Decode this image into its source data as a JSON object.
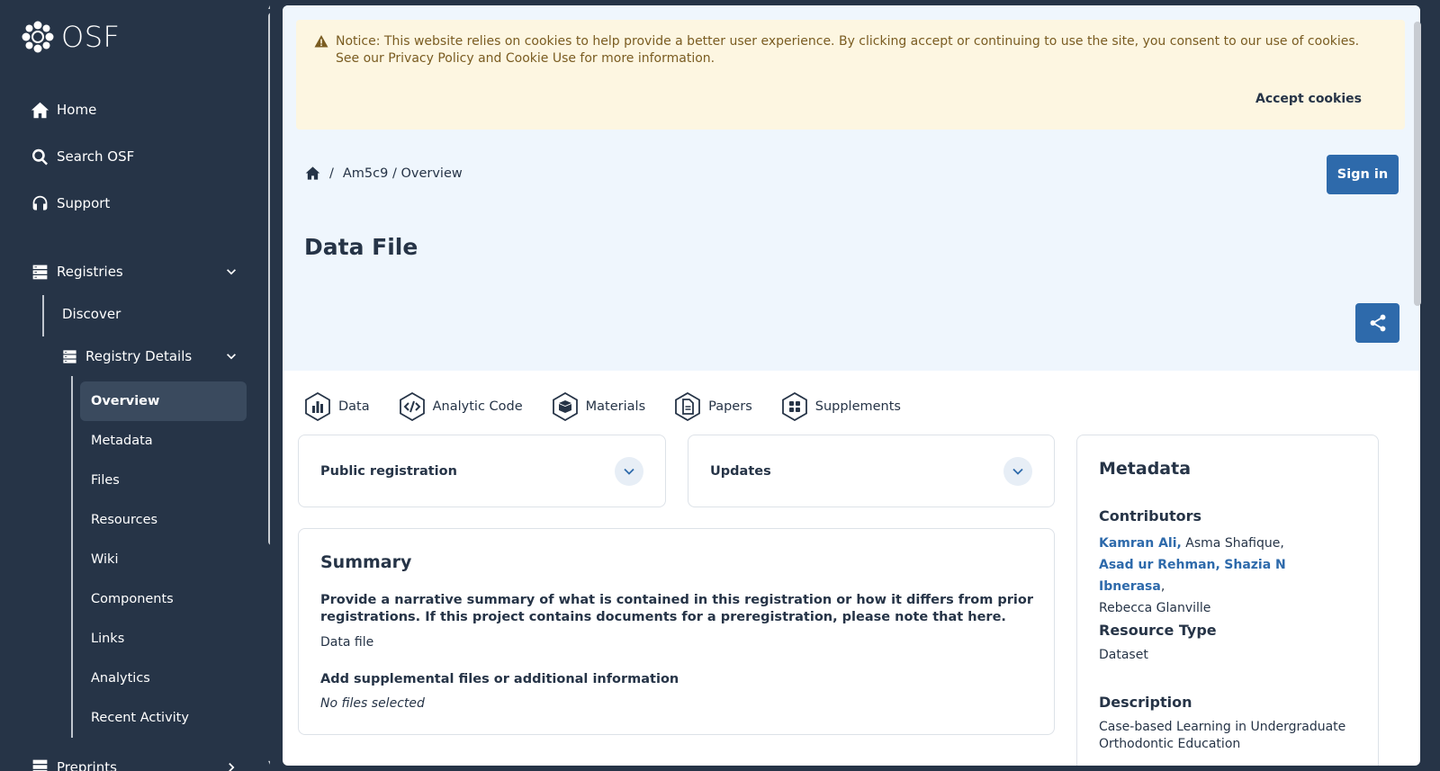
{
  "app": {
    "logo_text": "OSF"
  },
  "sidebar": {
    "nav": [
      {
        "label": "Home",
        "icon": "home-icon"
      },
      {
        "label": "Search OSF",
        "icon": "search-icon"
      },
      {
        "label": "Support",
        "icon": "headset-icon"
      }
    ],
    "registries_label": "Registries",
    "discover_label": "Discover",
    "registry_details_label": "Registry Details",
    "subnav": [
      "Overview",
      "Metadata",
      "Files",
      "Resources",
      "Wiki",
      "Components",
      "Links",
      "Analytics",
      "Recent Activity"
    ],
    "active_subnav": "Overview",
    "preprints_label": "Preprints"
  },
  "cookie": {
    "notice": "Notice: This website relies on cookies to help provide a better user experience. By clicking accept or continuing to use the site, you consent to our use of cookies. See our Privacy Policy and Cookie Use for more information.",
    "accept_label": "Accept cookies"
  },
  "breadcrumb": {
    "sep": "/",
    "path": "Am5c9 / Overview"
  },
  "signin_label": "Sign in",
  "page_title": "Data File",
  "badges": [
    "Data",
    "Analytic Code",
    "Materials",
    "Papers",
    "Supplements"
  ],
  "accordions": {
    "public_registration": "Public registration",
    "updates": "Updates"
  },
  "summary": {
    "heading": "Summary",
    "question": "Provide a narrative summary of what is contained in this registration or how it differs from prior registrations. If this project contains documents for a preregistration, please note that here.",
    "answer": "Data file",
    "supp_question": "Add supplemental files or additional information",
    "supp_answer": "No files selected"
  },
  "metadata": {
    "heading": "Metadata",
    "contributors_label": "Contributors",
    "contributors": {
      "c1": "Kamran Ali,",
      "c2": "Asma Shafique,",
      "c3": "Asad ur Rehman,",
      "c4": "Shazia N Ibnerasa",
      "c4_comma": ",",
      "c5": "Rebecca Glanville"
    },
    "resource_type_label": "Resource Type",
    "resource_type": "Dataset",
    "description_label": "Description",
    "description": "Case-based Learning in Undergraduate Orthodontic Education"
  },
  "colors": {
    "sidebar_bg": "#263447",
    "accent": "#2e6aab",
    "hero_bg": "#eff6fd",
    "cookie_bg": "#fdf6e1"
  }
}
